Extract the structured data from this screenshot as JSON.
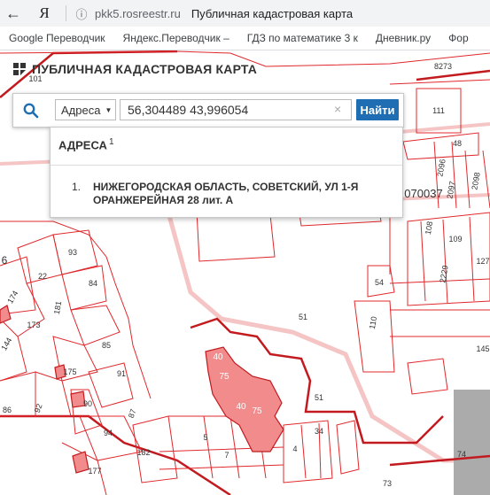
{
  "browser": {
    "back_glyph": "←",
    "home_glyph": "Я",
    "info_glyph": "ⓘ",
    "domain": "pkk5.rosreestr.ru",
    "page_title": "Публичная кадастровая карта"
  },
  "bookmarks": [
    "Google Переводчик",
    "Яндекс.Переводчик –",
    "ГДЗ по математике 3 к",
    "Дневник.ру",
    "Фор"
  ],
  "app": {
    "brand": "ПУБЛИЧНАЯ КАДАСТРОВАЯ КАРТА"
  },
  "search": {
    "type_label": "Адреса",
    "query": "56,304489 43,996054",
    "clear_glyph": "×",
    "find_label": "Найти"
  },
  "results": {
    "title": "АДРЕСА",
    "count": "1",
    "items": [
      {
        "num": "1.",
        "text": "НИЖЕГОРОДСКАЯ ОБЛАСТЬ, СОВЕТСКИЙ, УЛ 1-Я ОРАНЖЕРЕЙНАЯ 28 лит. А"
      }
    ]
  },
  "map": {
    "labels": [
      "101",
      "8273",
      "111",
      "48",
      "2096",
      "2097",
      "2098",
      "070037",
      "108",
      "109",
      "2229",
      "127",
      "6",
      "93",
      "22",
      "84",
      "174",
      "181",
      "54",
      "173",
      "51",
      "110",
      "144",
      "85",
      "40",
      "75",
      "91",
      "175",
      "145",
      "90",
      "86",
      "92",
      "87",
      "51",
      "34",
      "94",
      "182",
      "177",
      "5",
      "7",
      "4",
      "74",
      "73"
    ],
    "colors": {
      "line": "#e0282c",
      "fill": "#f28b8b",
      "road": "#f5c4c4"
    }
  }
}
